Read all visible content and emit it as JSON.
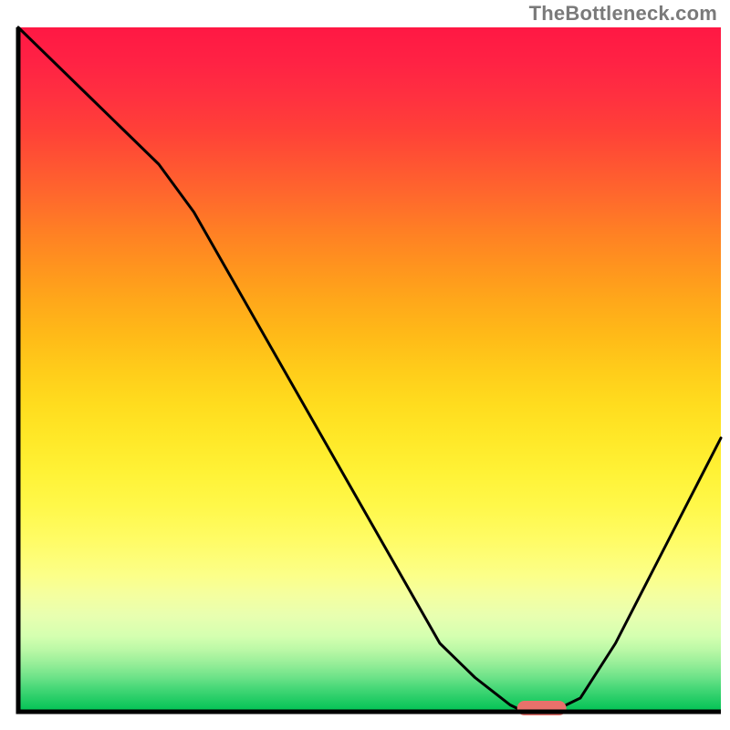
{
  "watermark": "TheBottleneck.com",
  "chart_data": {
    "type": "line",
    "title": "",
    "xlabel": "",
    "ylabel": "",
    "xlim": [
      0,
      100
    ],
    "ylim": [
      0,
      100
    ],
    "x": [
      0,
      5,
      10,
      15,
      20,
      25,
      30,
      35,
      40,
      45,
      50,
      55,
      60,
      65,
      70,
      72,
      76,
      80,
      85,
      90,
      95,
      100
    ],
    "values": [
      100,
      95,
      90,
      85,
      80,
      73,
      64,
      55,
      46,
      37,
      28,
      19,
      10,
      5,
      1,
      0,
      0,
      2,
      10,
      20,
      30,
      40
    ],
    "marker": {
      "x_start": 71,
      "x_end": 78,
      "y": 0,
      "color": "#e8716b"
    },
    "gradient_stops": [
      {
        "offset": 0.0,
        "color": "#ff1844"
      },
      {
        "offset": 0.05,
        "color": "#ff2244"
      },
      {
        "offset": 0.1,
        "color": "#ff3040"
      },
      {
        "offset": 0.15,
        "color": "#ff4038"
      },
      {
        "offset": 0.2,
        "color": "#ff5532"
      },
      {
        "offset": 0.25,
        "color": "#ff6a2c"
      },
      {
        "offset": 0.3,
        "color": "#ff8024"
      },
      {
        "offset": 0.35,
        "color": "#ff941e"
      },
      {
        "offset": 0.4,
        "color": "#ffa81a"
      },
      {
        "offset": 0.45,
        "color": "#ffba18"
      },
      {
        "offset": 0.5,
        "color": "#ffcc1a"
      },
      {
        "offset": 0.55,
        "color": "#ffdc1e"
      },
      {
        "offset": 0.6,
        "color": "#ffe828"
      },
      {
        "offset": 0.65,
        "color": "#fff236"
      },
      {
        "offset": 0.7,
        "color": "#fff84a"
      },
      {
        "offset": 0.75,
        "color": "#fffc66"
      },
      {
        "offset": 0.8,
        "color": "#fcff88"
      },
      {
        "offset": 0.83,
        "color": "#f4ffa0"
      },
      {
        "offset": 0.86,
        "color": "#e8ffb0"
      },
      {
        "offset": 0.89,
        "color": "#d4ffb0"
      },
      {
        "offset": 0.91,
        "color": "#baf8a6"
      },
      {
        "offset": 0.93,
        "color": "#96ee98"
      },
      {
        "offset": 0.95,
        "color": "#6ce288"
      },
      {
        "offset": 0.965,
        "color": "#48d878"
      },
      {
        "offset": 0.98,
        "color": "#28ce68"
      },
      {
        "offset": 0.99,
        "color": "#14c85e"
      },
      {
        "offset": 1.0,
        "color": "#00c254"
      }
    ],
    "axis_color": "#000000",
    "line_color": "#000000"
  }
}
